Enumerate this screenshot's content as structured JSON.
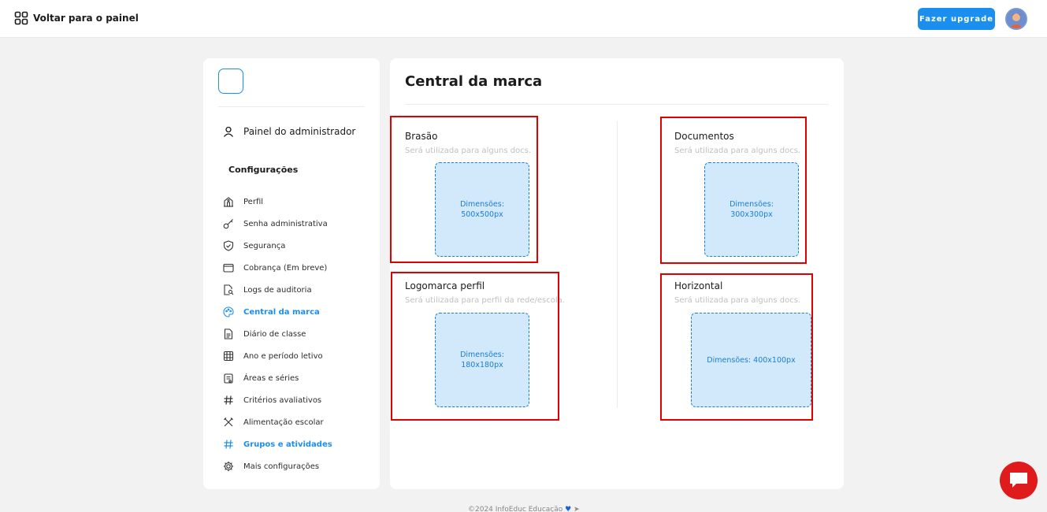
{
  "topbar": {
    "back_label": "Voltar para o painel",
    "upgrade_label": "Fazer upgrade"
  },
  "sidebar": {
    "admin_label": "Painel do administrador",
    "section_title": "Configurações",
    "items": [
      {
        "label": "Perfil",
        "icon": "building-icon"
      },
      {
        "label": "Senha administrativa",
        "icon": "key-icon"
      },
      {
        "label": "Segurança",
        "icon": "shield-icon"
      },
      {
        "label": "Cobrança (Em breve)",
        "icon": "wallet-icon"
      },
      {
        "label": "Logs de auditoria",
        "icon": "file-search-icon"
      },
      {
        "label": "Central da marca",
        "icon": "palette-icon",
        "active": true
      },
      {
        "label": "Diário de classe",
        "icon": "document-icon"
      },
      {
        "label": "Ano e período letivo",
        "icon": "calendar-icon"
      },
      {
        "label": "Áreas e séries",
        "icon": "clipboard-icon"
      },
      {
        "label": "Critérios avaliativos",
        "icon": "hash-icon"
      },
      {
        "label": "Alimentação escolar",
        "icon": "utensils-icon"
      },
      {
        "label": "Grupos e atividades",
        "icon": "hash-icon",
        "active": true
      },
      {
        "label": "Mais configurações",
        "icon": "gear-icon"
      }
    ]
  },
  "main": {
    "title": "Central da marca",
    "cards": [
      {
        "title": "Brasão",
        "desc": "Será utilizada para alguns docs.",
        "dims": "Dimensões:\n500x500px"
      },
      {
        "title": "Documentos",
        "desc": "Será utilizada para alguns docs.",
        "dims": "Dimensões:\n300x300px"
      },
      {
        "title": "Logomarca perfil",
        "desc": "Será utilizada para perfil da rede/escola.",
        "dims": "Dimensões:\n180x180px"
      },
      {
        "title": "Horizontal",
        "desc": "Será utilizada para alguns docs.",
        "dims": "Dimensões: 400x100px"
      }
    ]
  },
  "footer": {
    "text": "©2024 InfoEduc Educação"
  },
  "colors": {
    "accent": "#1a8ff0",
    "highlight": "#e00000",
    "chat": "#e01b1b"
  }
}
